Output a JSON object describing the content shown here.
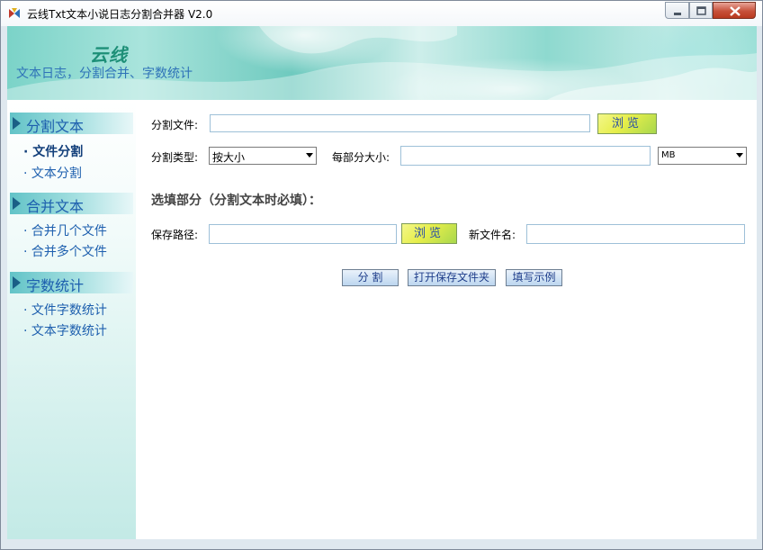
{
  "window": {
    "title": "云线Txt文本小说日志分割合并器 V2.0"
  },
  "banner": {
    "title": "云线",
    "subtitle": "文本日志，分割合并、字数统计"
  },
  "sidebar": {
    "sections": [
      {
        "header": "分割文本",
        "items": [
          "· 文件分割",
          "· 文本分割"
        ]
      },
      {
        "header": "合并文本",
        "items": [
          "· 合并几个文件",
          "· 合并多个文件"
        ]
      },
      {
        "header": "字数统计",
        "items": [
          "· 文件字数统计",
          "· 文本字数统计"
        ]
      }
    ]
  },
  "form": {
    "split_file_label": "分割文件:",
    "split_file_value": "",
    "browse_label": "浏览",
    "split_type_label": "分割类型:",
    "split_type_value": "按大小",
    "part_size_label": "每部分大小:",
    "part_size_value": "",
    "unit_value": "MB",
    "optional_title": "选填部分（分割文本时必填）：",
    "save_path_label": "保存路径:",
    "save_path_value": "",
    "save_browse_label": "浏览",
    "new_name_label": "新文件名:",
    "new_name_value": ""
  },
  "actions": {
    "split_label": "分 割",
    "open_folder_label": "打开保存文件夹",
    "example_label": "填写示例"
  },
  "colors": {
    "banner_teal": "#7bd3c8",
    "sidebar_text": "#1d5fae",
    "browse_yellow": "#e6ee4a",
    "action_blue": "#bcd6ef"
  }
}
